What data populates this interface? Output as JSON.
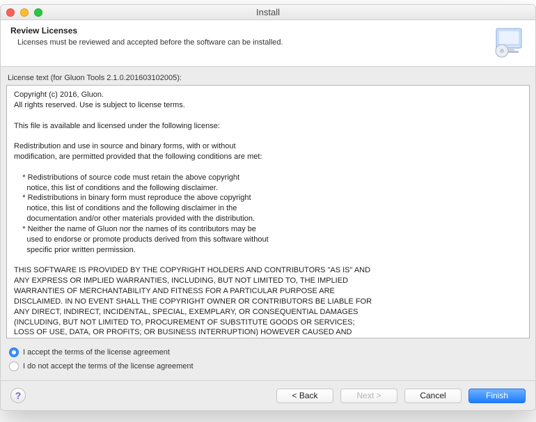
{
  "window": {
    "title": "Install"
  },
  "header": {
    "title": "Review Licenses",
    "subtitle": "Licenses must be reviewed and accepted before the software can be installed."
  },
  "license": {
    "label": "License text (for Gluon Tools 2.1.0.201603102005):",
    "text": "Copyright (c) 2016, Gluon.\nAll rights reserved. Use is subject to license terms.\n\nThis file is available and licensed under the following license:\n\nRedistribution and use in source and binary forms, with or without\nmodification, are permitted provided that the following conditions are met:\n\n    * Redistributions of source code must retain the above copyright\n      notice, this list of conditions and the following disclaimer.\n    * Redistributions in binary form must reproduce the above copyright\n      notice, this list of conditions and the following disclaimer in the\n      documentation and/or other materials provided with the distribution.\n    * Neither the name of Gluon nor the names of its contributors may be\n      used to endorse or promote products derived from this software without\n      specific prior written permission.\n\nTHIS SOFTWARE IS PROVIDED BY THE COPYRIGHT HOLDERS AND CONTRIBUTORS \"AS IS\" AND\nANY EXPRESS OR IMPLIED WARRANTIES, INCLUDING, BUT NOT LIMITED TO, THE IMPLIED\nWARRANTIES OF MERCHANTABILITY AND FITNESS FOR A PARTICULAR PURPOSE ARE\nDISCLAIMED. IN NO EVENT SHALL THE COPYRIGHT OWNER OR CONTRIBUTORS BE LIABLE FOR\nANY DIRECT, INDIRECT, INCIDENTAL, SPECIAL, EXEMPLARY, OR CONSEQUENTIAL DAMAGES\n(INCLUDING, BUT NOT LIMITED TO, PROCUREMENT OF SUBSTITUTE GOODS OR SERVICES;\nLOSS OF USE, DATA, OR PROFITS; OR BUSINESS INTERRUPTION) HOWEVER CAUSED AND\nON ANY THEORY OF LIABILITY, WHETHER IN CONTRACT, STRICT LIABILITY, OR TORT\n(INCLUDING NEGLIGENCE OR OTHERWISE) ARISING IN ANY WAY OUT OF THE USE OF THIS\nSOFTWARE, EVEN IF ADVISED OF THE POSSIBILITY OF SUCH DAMAGE."
  },
  "radios": {
    "accept": "I accept the terms of the license agreement",
    "decline": "I do not accept the terms of the license agreement",
    "selected": "accept"
  },
  "buttons": {
    "back": "< Back",
    "next": "Next >",
    "cancel": "Cancel",
    "finish": "Finish"
  }
}
